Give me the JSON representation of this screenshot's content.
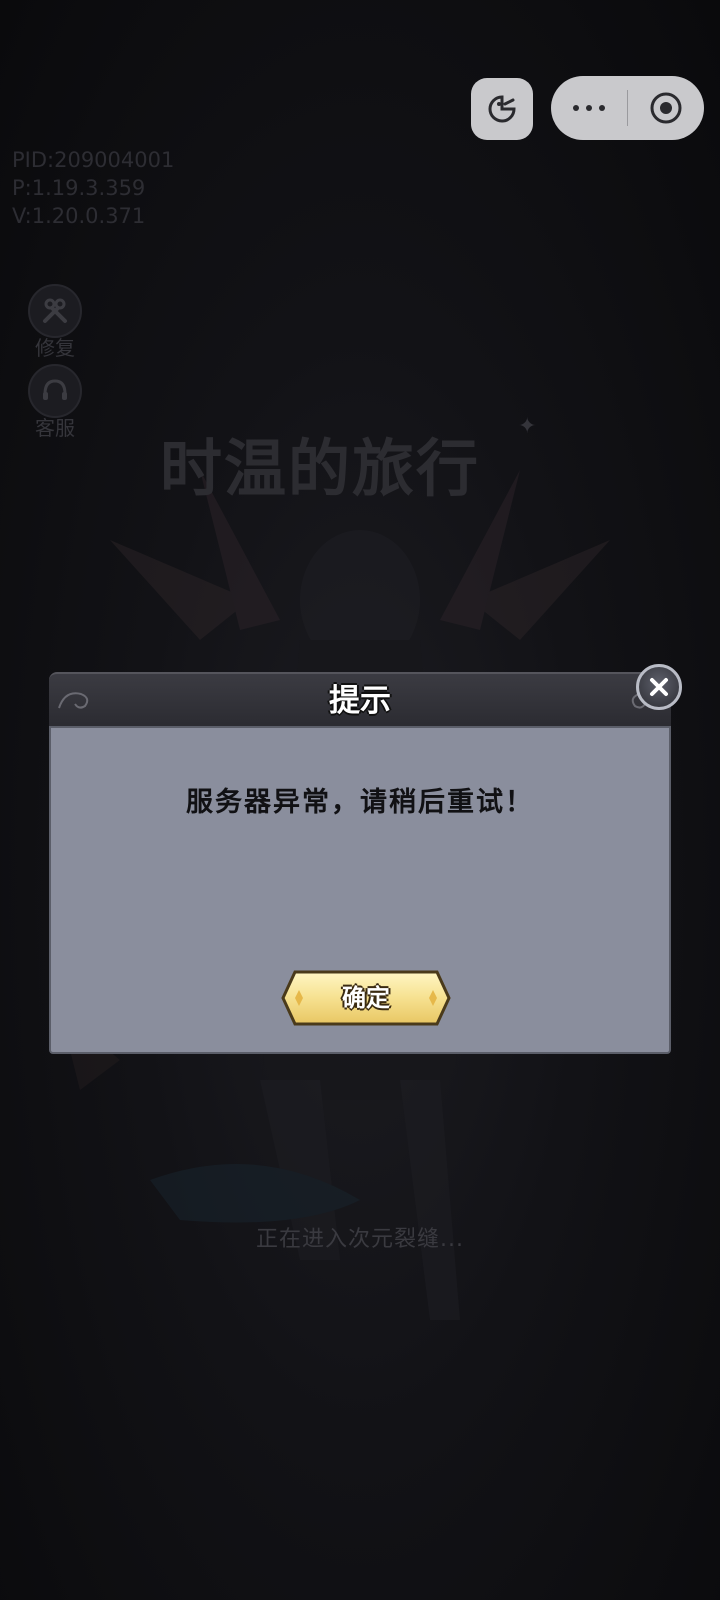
{
  "debug": {
    "pid": "PID:209004001",
    "p": "P:1.19.3.359",
    "v": "V:1.20.0.371"
  },
  "side_tools": {
    "repair_label": "修复",
    "service_label": "客服"
  },
  "game": {
    "logo_text": "时温的旅行",
    "loading_text": "正在进入次元裂缝..."
  },
  "dialog": {
    "title": "提示",
    "message": "服务器异常，请稍后重试！",
    "confirm_label": "确定"
  },
  "icons": {
    "capsule_game": "game-controller-icon",
    "capsule_more": "more-dots-icon",
    "capsule_close": "close-circle-icon",
    "dialog_close": "close-x-icon",
    "repair": "wrench-icon",
    "service": "headset-icon"
  },
  "colors": {
    "dialog_body": "#8a8e9d",
    "dialog_header": "#2f2f35",
    "confirm_button": "#f6e190",
    "capsule": "#c9c9cc"
  }
}
